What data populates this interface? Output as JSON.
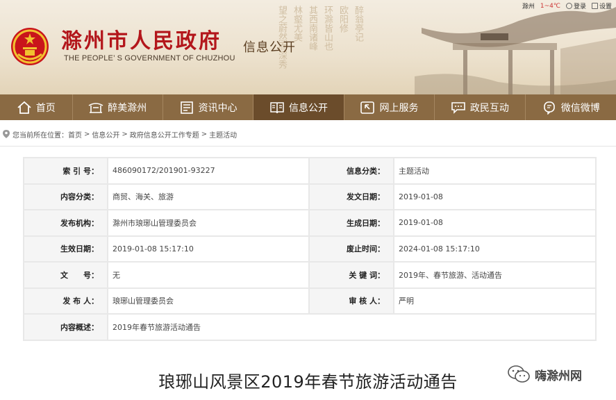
{
  "header": {
    "title": "滁州市人民政府",
    "subtitle": "THE PEOPLE’ S GOVERNMENT OF CHUZHOU",
    "section": "信息公开",
    "calligraphy": [
      "环滁皆山也",
      "其西南诸峰",
      "林壑尤美",
      "望之蔚然而深秀",
      "欧阳修",
      "醉翁亭记"
    ],
    "topbar": {
      "city": "滁州",
      "temperature": "1~4℃",
      "login": "登录",
      "settings": "设置"
    }
  },
  "nav": {
    "items": [
      {
        "label": "首页",
        "icon": "home-icon"
      },
      {
        "label": "醉美滁州",
        "icon": "pavilion-icon"
      },
      {
        "label": "资讯中心",
        "icon": "news-icon"
      },
      {
        "label": "信息公开",
        "icon": "book-icon",
        "active": true
      },
      {
        "label": "网上服务",
        "icon": "service-icon"
      },
      {
        "label": "政民互动",
        "icon": "chat-icon"
      },
      {
        "label": "微信微博",
        "icon": "wechat-icon"
      }
    ]
  },
  "breadcrumb": {
    "prefix": "您当前所在位置：",
    "items": [
      "首页",
      "信息公开",
      "政府信息公开工作专题",
      "主题活动"
    ]
  },
  "info": {
    "rows": [
      {
        "k1": "索 引 号：",
        "v1": "486090172/201901-93227",
        "k2": "信息分类：",
        "v2": "主题活动"
      },
      {
        "k1": "内容分类：",
        "v1": "商贸、海关、旅游",
        "k2": "发文日期：",
        "v2": "2019-01-08"
      },
      {
        "k1": "发布机构：",
        "v1": "滁州市琅琊山管理委员会",
        "k2": "生成日期：",
        "v2": "2019-01-08"
      },
      {
        "k1": "生效日期：",
        "v1": "2019-01-08 15:17:10",
        "k2": "废止时间：",
        "v2": "2024-01-08 15:17:10"
      },
      {
        "k1": "文　　号：",
        "v1": "无",
        "k2": "关 键 词：",
        "v2": "2019年、春节旅游、活动通告"
      },
      {
        "k1": "发 布 人：",
        "v1": "琅琊山管理委员会",
        "k2": "审 核 人：",
        "v2": "严明"
      }
    ],
    "summary_label": "内容概述：",
    "summary_value": "2019年春节旅游活动通告"
  },
  "article": {
    "title": "琅琊山风景区2019年春节旅游活动通告"
  },
  "watermark": {
    "text": "嗨滁州网"
  },
  "colors": {
    "nav_bg": "#8a6a43",
    "nav_active": "#6b4c2b",
    "title_red": "#b3161b"
  }
}
